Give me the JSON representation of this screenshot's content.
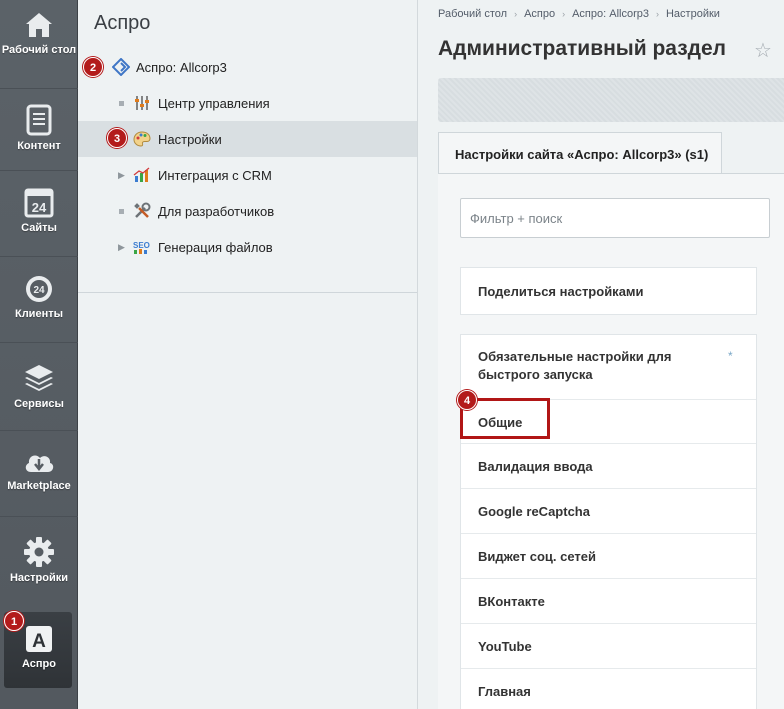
{
  "iconbar": {
    "items": [
      {
        "label": "Рабочий стол",
        "icon": "home-icon"
      },
      {
        "label": "Контент",
        "icon": "document-icon"
      },
      {
        "label": "Сайты",
        "icon": "calendar-24-icon"
      },
      {
        "label": "Клиенты",
        "icon": "clients-24-icon"
      },
      {
        "label": "Сервисы",
        "icon": "layers-icon"
      },
      {
        "label": "Marketplace",
        "icon": "cloud-download-icon"
      },
      {
        "label": "Настройки",
        "icon": "gear-icon"
      },
      {
        "label": "Аспро",
        "icon": "aspro-a-icon"
      }
    ]
  },
  "tree": {
    "title": "Аспро",
    "items": [
      {
        "label": "Аспро: Allcorp3",
        "icon": "aspro-diamond-icon"
      },
      {
        "label": "Центр управления",
        "icon": "control-sliders-icon"
      },
      {
        "label": "Настройки",
        "icon": "palette-icon"
      },
      {
        "label": "Интеграция с CRM",
        "icon": "chart-icon"
      },
      {
        "label": "Для разработчиков",
        "icon": "tools-icon"
      },
      {
        "label": "Генерация файлов",
        "icon": "seo-icon"
      }
    ]
  },
  "main": {
    "breadcrumbs": [
      "Рабочий стол",
      "Аспро",
      "Аспро: Allcorp3",
      "Настройки"
    ],
    "title": "Административный раздел",
    "tab_label": "Настройки сайта «Аспро: Allcorp3» (s1)",
    "filter_placeholder": "Фильтр + поиск",
    "share_label": "Поделиться настройками",
    "required_label": "Обязательные настройки для быстрого запуска",
    "required_mark": "*",
    "menu": [
      "Общие",
      "Валидация ввода",
      "Google reCaptcha",
      "Виджет соц. сетей",
      "ВКонтакте",
      "YouTube",
      "Главная"
    ]
  },
  "badges": [
    "1",
    "2",
    "3",
    "4"
  ],
  "colors": {
    "badge": "#b31b1b",
    "highlight": "#b11616",
    "iconbar": "#575d63",
    "panel": "#eef2f3"
  }
}
